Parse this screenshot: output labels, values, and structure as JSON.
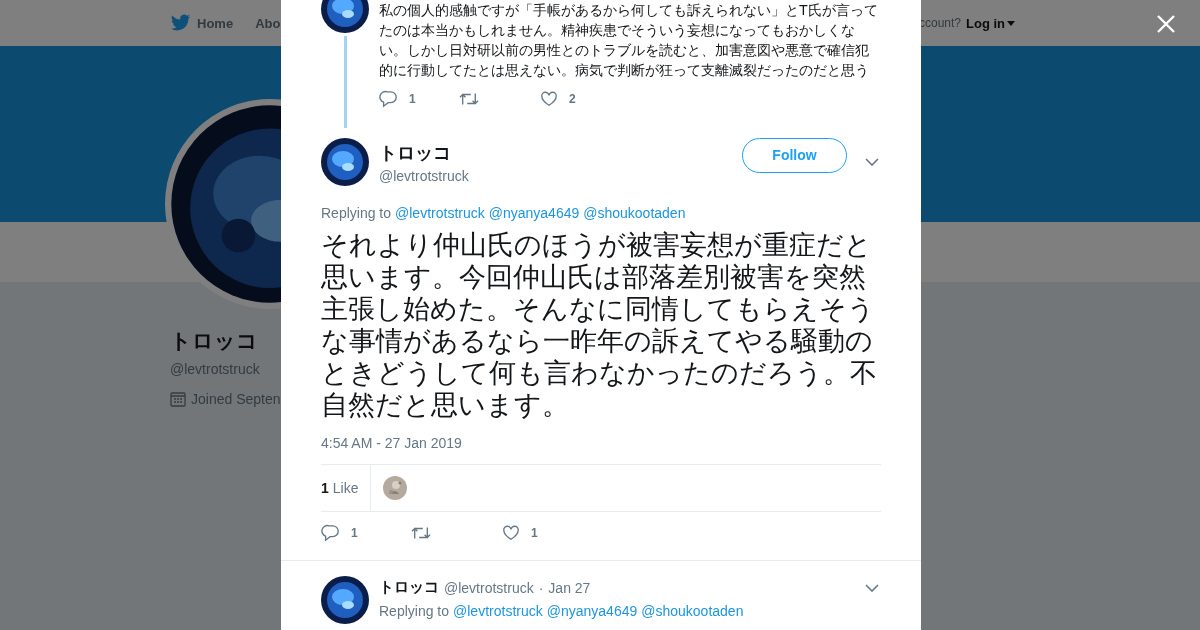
{
  "nav": {
    "items": [
      {
        "label": "Home"
      },
      {
        "label": "Abo"
      }
    ],
    "account_prompt": "ccount?",
    "login": "Log in"
  },
  "profile": {
    "name": "トロッコ",
    "handle": "@levtrotstruck",
    "joined": "Joined Septen"
  },
  "parent_tweet": {
    "text": "私の個人的感触ですが「手帳があるから何しても訴えられない」とT氏が言ってたのは本当かもしれません。精神疾患でそういう妄想になってもおかしくない。しかし日対研以前の男性とのトラブルを読むと、加害意図や悪意で確信犯的に行動してたとは思えない。病気で判断が狂って支離滅裂だったのだと思う",
    "replies": "1",
    "likes": "2"
  },
  "tweet": {
    "name": "トロッコ",
    "handle": "@levtrotstruck",
    "follow": "Follow",
    "replying_label": "Replying to",
    "mentions": [
      "@levtrotstruck",
      "@nyanya4649",
      "@shoukootaden"
    ],
    "text": "それより仲山氏のほうが被害妄想が重症だと思います。今回仲山氏は部落差別被害を突然主張し始めた。そんなに同情してもらえそうな事情があるなら一昨年の訴えてやる騒動のときどうして何も言わなかったのだろう。不自然だと思います。",
    "timestamp": "4:54 AM - 27 Jan 2019",
    "like_count": "1",
    "like_label": "Like",
    "replies": "1",
    "likes": "1"
  },
  "reply_tweet": {
    "name": "トロッコ",
    "handle": "@levtrotstruck",
    "separator": "·",
    "date": "Jan 27",
    "replying_label": "Replying to",
    "mentions": [
      "@levtrotstruck",
      "@nyanya4649",
      "@shoukootaden"
    ]
  }
}
